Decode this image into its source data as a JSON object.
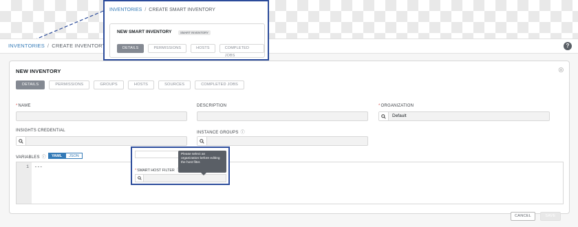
{
  "breadcrumb": {
    "parent": "INVENTORIES",
    "separator": "/",
    "current": "CREATE INVENTORY"
  },
  "form": {
    "title": "NEW INVENTORY",
    "tabs": [
      "DETAILS",
      "PERMISSIONS",
      "GROUPS",
      "HOSTS",
      "SOURCES",
      "COMPLETED JOBS"
    ],
    "active_tab": "DETAILS",
    "fields": {
      "name_label": "NAME",
      "description_label": "DESCRIPTION",
      "organization_label": "ORGANIZATION",
      "organization_value": "Default",
      "insights_label": "INSIGHTS CREDENTIAL",
      "instance_groups_label": "INSTANCE GROUPS",
      "variables_label": "VARIABLES"
    },
    "variables_toggle": [
      "YAML",
      "JSON"
    ],
    "variables_mode": "YAML",
    "editor": {
      "line_number": "1",
      "content": "---"
    },
    "buttons": {
      "cancel": "CANCEL",
      "save": "SAVE"
    }
  },
  "zoom_top": {
    "breadcrumb_parent": "INVENTORIES",
    "breadcrumb_separator": "/",
    "breadcrumb_current": "CREATE SMART INVENTORY",
    "title": "NEW SMART INVENTORY",
    "badge": "SMART INVENTORY",
    "tabs": [
      "DETAILS",
      "PERMISSIONS",
      "HOSTS",
      "COMPLETED JOBS"
    ]
  },
  "zoom_bottom": {
    "field_label": "SMART HOST FILTER",
    "tooltip": "Please select an organization before editing the host filter."
  },
  "colors": {
    "accent": "#337ab7",
    "required": "#d9534f",
    "callout_border": "#2a4a9a",
    "active_tab": "#848992"
  },
  "icons": {
    "help": "help-circle-icon",
    "lookup": "search-icon",
    "close": "close-icon"
  }
}
